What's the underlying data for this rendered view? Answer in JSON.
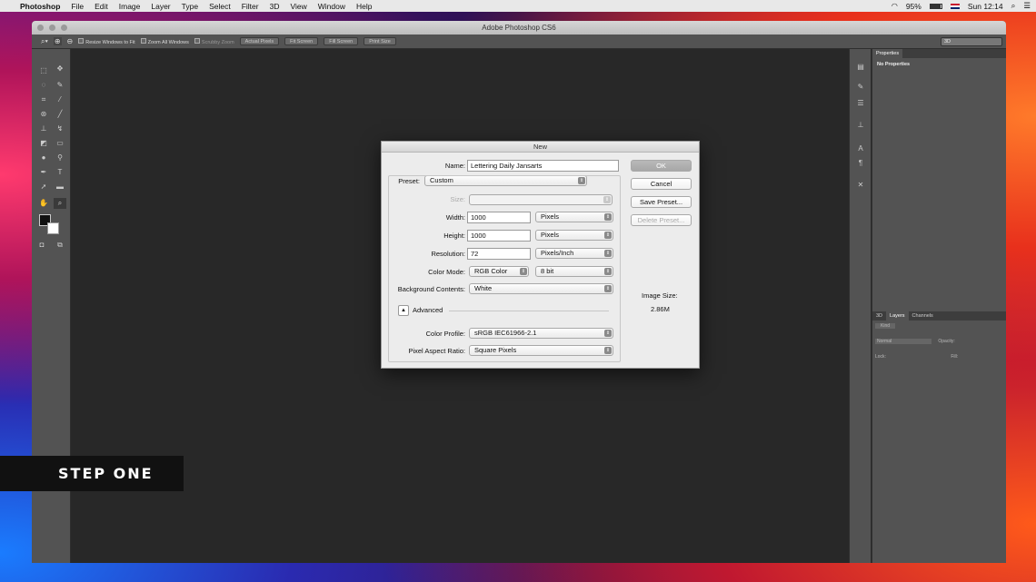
{
  "menubar": {
    "items": [
      "Photoshop",
      "File",
      "Edit",
      "Image",
      "Layer",
      "Type",
      "Select",
      "Filter",
      "3D",
      "View",
      "Window",
      "Help"
    ],
    "battery": "95%",
    "clock": "Sun 12:14"
  },
  "window": {
    "title": "Adobe Photoshop CS6"
  },
  "options": {
    "resize_windows": "Resize Windows to Fit",
    "zoom_all": "Zoom All Windows",
    "scrubby": "Scrubby Zoom",
    "actual_pixels": "Actual Pixels",
    "fit_screen": "Fit Screen",
    "fill_screen": "Fill Screen",
    "print_size": "Print Size",
    "workspace": "3D"
  },
  "panels": {
    "properties_tab": "Properties",
    "no_properties": "No Properties",
    "tab_3d": "3D",
    "tab_layers": "Layers",
    "tab_channels": "Channels",
    "kind": "Kind",
    "blend_mode": "Normal",
    "opacity_label": "Opacity:",
    "lock_label": "Lock:",
    "fill_label": "Fill:"
  },
  "dialog": {
    "title": "New",
    "name_label": "Name:",
    "name_value": "Lettering Daily Jansarts",
    "preset_label": "Preset:",
    "preset_value": "Custom",
    "size_label": "Size:",
    "width_label": "Width:",
    "width_value": "1000",
    "width_unit": "Pixels",
    "height_label": "Height:",
    "height_value": "1000",
    "height_unit": "Pixels",
    "resolution_label": "Resolution:",
    "resolution_value": "72",
    "resolution_unit": "Pixels/Inch",
    "color_mode_label": "Color Mode:",
    "color_mode_value": "RGB Color",
    "bit_depth": "8 bit",
    "bg_label": "Background Contents:",
    "bg_value": "White",
    "advanced_label": "Advanced",
    "color_profile_label": "Color Profile:",
    "color_profile_value": "sRGB IEC61966-2.1",
    "aspect_label": "Pixel Aspect Ratio:",
    "aspect_value": "Square Pixels",
    "ok": "OK",
    "cancel": "Cancel",
    "save_preset": "Save Preset...",
    "delete_preset": "Delete Preset...",
    "image_size_label": "Image Size:",
    "image_size_value": "2.86M"
  },
  "overlay": {
    "step": "STEP ONE"
  }
}
